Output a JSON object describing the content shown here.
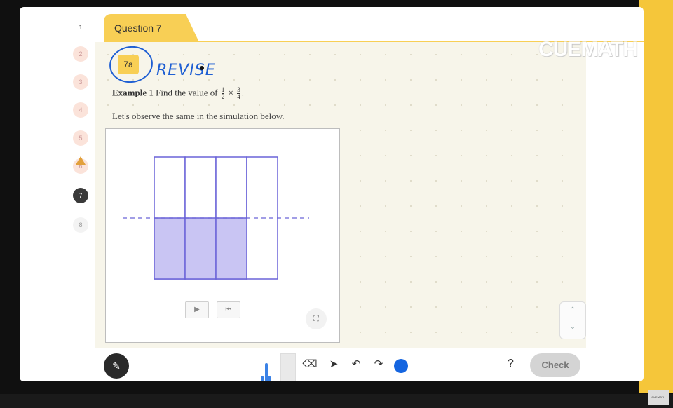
{
  "question_nav": [
    {
      "label": "1",
      "state": "plain"
    },
    {
      "label": "2",
      "state": "visited"
    },
    {
      "label": "3",
      "state": "visited"
    },
    {
      "label": "4",
      "state": "visited"
    },
    {
      "label": "5",
      "state": "visited"
    },
    {
      "label": "6",
      "state": "visited"
    },
    {
      "label": "7",
      "state": "current"
    },
    {
      "label": "8",
      "state": "unvisited"
    }
  ],
  "header": {
    "tab_title": "Question 7"
  },
  "logo": {
    "text": "CUEMATH"
  },
  "content": {
    "part_badge": "7a",
    "handwritten_note": "REVISE",
    "example_label": "Example",
    "example_number": "1",
    "example_text": "Find the value of",
    "fraction_1": {
      "num": "1",
      "den": "2"
    },
    "times_symbol": "×",
    "fraction_2": {
      "num": "3",
      "den": "4"
    },
    "period": ".",
    "observe_text": "Let's observe the same in the simulation below."
  },
  "simulation": {
    "columns": 4,
    "shaded_columns": 3,
    "shaded_fraction_of_height": 0.5,
    "fill_color": "#c9c5f3",
    "stroke_color": "#6a63d8",
    "play_icon": "play-icon",
    "reset_icon": "rewind-icon",
    "expand_icon": "expand-icon"
  },
  "toolbar": {
    "check_label": "Check",
    "help_label": "?",
    "selected_color": "#1565e0"
  },
  "watermark": {
    "text": "CUEMATH"
  }
}
